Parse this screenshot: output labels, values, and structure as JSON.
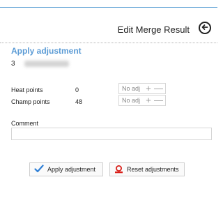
{
  "header": {
    "title": "Edit Merge Result",
    "back_icon": "arrow-left-circle-icon"
  },
  "section": {
    "title": "Apply adjustment",
    "competitor_number": "3"
  },
  "rows": [
    {
      "label": "Heat points",
      "value": "0",
      "placeholder": "No adj"
    },
    {
      "label": "Champ points",
      "value": "48",
      "placeholder": "No adj"
    }
  ],
  "row_controls": {
    "plus": "+",
    "minus": "—"
  },
  "comment": {
    "label": "Comment",
    "value": ""
  },
  "buttons": {
    "apply": "Apply adjustment",
    "reset": "Reset adjustments"
  },
  "colors": {
    "accent": "#5b9bd5",
    "check": "#2e7fd6",
    "reset_icon": "#d9201a"
  }
}
